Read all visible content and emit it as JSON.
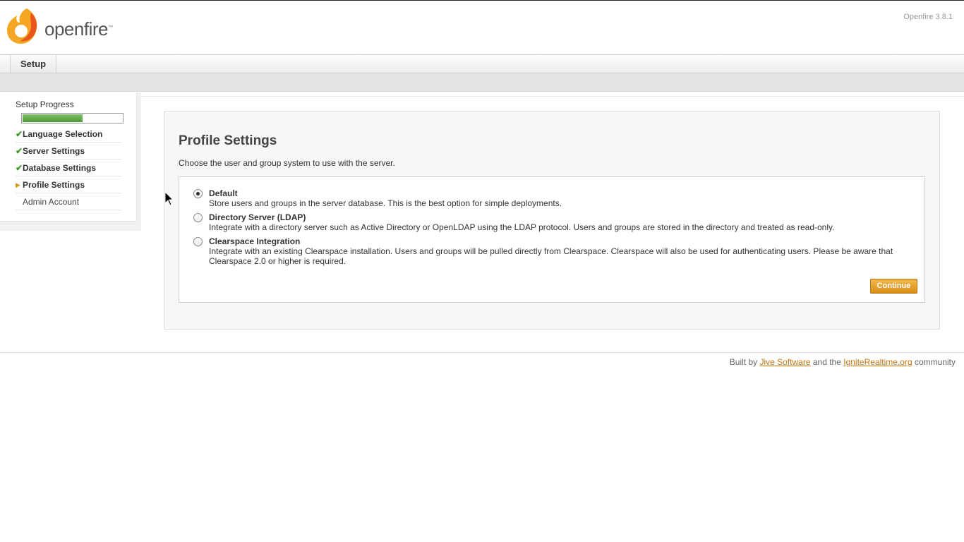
{
  "header": {
    "logo_text": "openfire",
    "logo_tm": "™",
    "version": "Openfire 3.8.1"
  },
  "tabs": [
    {
      "label": "Setup"
    }
  ],
  "sidebar": {
    "progress_label": "Setup Progress",
    "progress_fraction": 0.6,
    "steps": [
      {
        "label": "Language Selection",
        "state": "done",
        "mark": "✔"
      },
      {
        "label": "Server Settings",
        "state": "done",
        "mark": "✔"
      },
      {
        "label": "Database Settings",
        "state": "done",
        "mark": "✔"
      },
      {
        "label": "Profile Settings",
        "state": "current",
        "mark": "▶"
      },
      {
        "label": "Admin Account",
        "state": "todo",
        "mark": ""
      }
    ]
  },
  "main": {
    "title": "Profile Settings",
    "description": "Choose the user and group system to use with the server.",
    "options": [
      {
        "title": "Default",
        "description": "Store users and groups in the server database. This is the best option for simple deployments.",
        "checked": true
      },
      {
        "title": "Directory Server (LDAP)",
        "description": "Integrate with a directory server such as Active Directory or OpenLDAP using the LDAP protocol. Users and groups are stored in the directory and treated as read-only.",
        "checked": false
      },
      {
        "title": "Clearspace Integration",
        "description": "Integrate with an existing Clearspace installation. Users and groups will be pulled directly from Clearspace. Clearspace will also be used for authenticating users. Please be aware that Clearspace 2.0 or higher is required.",
        "checked": false
      }
    ],
    "continue_label": "Continue"
  },
  "footer": {
    "prefix": "Built by",
    "link1": "Jive Software",
    "middle": "and the",
    "link2": "IgniteRealtime.org",
    "suffix": "community"
  },
  "colors": {
    "accent": "#d98d17",
    "progress": "#5aa844",
    "link": "#c2770f"
  }
}
